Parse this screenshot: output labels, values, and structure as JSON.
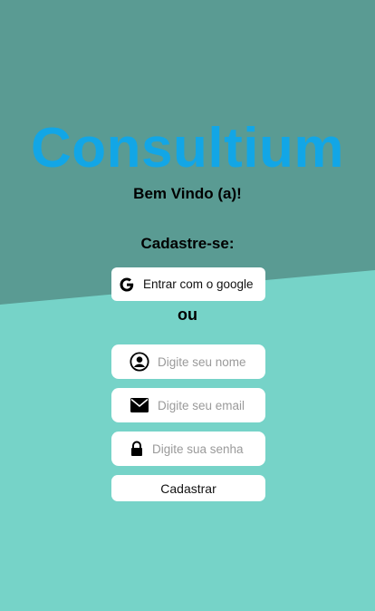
{
  "app": {
    "brand": "Consultium",
    "welcome": "Bem Vindo (a)!",
    "signup_heading": "Cadastre-se:"
  },
  "google_button": {
    "label": "Entrar com o google",
    "icon": "google-icon"
  },
  "separator": "ou",
  "form": {
    "name": {
      "placeholder": "Digite seu nome",
      "value": "",
      "icon": "user-circle-icon"
    },
    "email": {
      "placeholder": "Digite seu email",
      "value": "",
      "icon": "envelope-icon"
    },
    "password": {
      "placeholder": "Digite sua senha",
      "value": "",
      "icon": "lock-icon"
    },
    "submit_label": "Cadastrar"
  },
  "colors": {
    "brand": "#12a6e6",
    "background_top": "#5a9b93",
    "background_bottom": "#76d3c8",
    "card": "#ffffff"
  }
}
